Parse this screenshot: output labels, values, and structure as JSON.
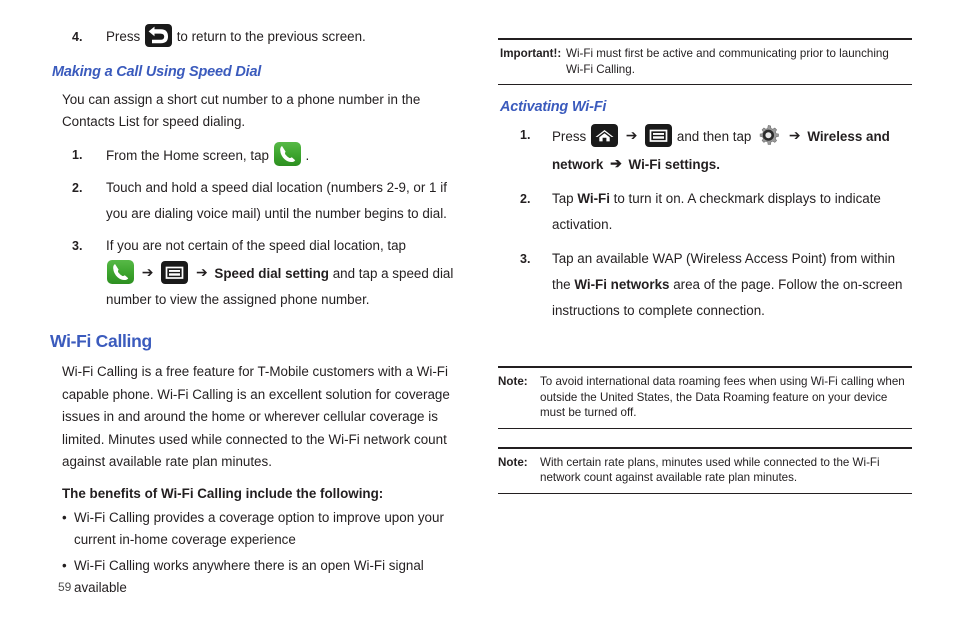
{
  "page": {
    "number": "59",
    "accent_color": "#3b5bbd",
    "text_color": "#231f20"
  },
  "left_column": {
    "step4": {
      "number": "4.",
      "text_before": "Press",
      "icon": "back-arrow-icon",
      "text_after": "to return to the previous screen."
    },
    "speed_dial_heading": "Making a Call Using Speed Dial",
    "speed_dial_intro": "You can assign a short cut number to a phone number in the Contacts List for speed dialing.",
    "speed_dial_steps": [
      {
        "number": "1.",
        "text_before": "From the Home screen, tap",
        "icon": "phone-icon",
        "text_after": "."
      },
      {
        "number": "2.",
        "text": "Touch and hold a speed dial location (numbers 2-9, or 1 if you are dialing voice mail) until the number begins to dial."
      },
      {
        "number": "3.",
        "line1": "If you are not certain of the speed dial location, tap",
        "icon1": "phone-icon",
        "arrow": "➔",
        "icon2": "menu-icon",
        "bold_text": "Speed dial setting",
        "text_after": "and tap a speed dial number to view the assigned phone number."
      }
    ],
    "wifi_calling_heading": "Wi-Fi Calling",
    "wifi_calling_body": "Wi-Fi Calling is a free feature for T-Mobile customers with a Wi-Fi capable phone. Wi-Fi Calling is an excellent solution for coverage issues in and around the home or wherever cellular coverage is limited. Minutes used while connected to the Wi-Fi network count against available rate plan minutes.",
    "benefits_heading": "The benefits of Wi-Fi Calling include the following:",
    "benefits": [
      "Wi-Fi Calling provides a coverage option to improve upon your current in-home coverage experience",
      "Wi-Fi Calling works anywhere there is an open Wi-Fi signal available"
    ],
    "bullet_glyph": "•"
  },
  "right_column": {
    "important_note": {
      "label": "Important!:",
      "text": "Wi-Fi must first be active and communicating prior to launching Wi-Fi Calling."
    },
    "activating_heading": "Activating Wi-Fi",
    "steps": [
      {
        "number": "1.",
        "text_before": "Press",
        "icon1": "home-icon",
        "arrow1": "➔",
        "icon2": "menu-icon",
        "text_middle": "and then tap",
        "icon3": "settings-gear-icon",
        "arrow2": "➔",
        "bold1": "Wireless and network",
        "arrow3": "➔",
        "bold2": "Wi-Fi settings."
      },
      {
        "number": "2.",
        "text_before": "Tap",
        "bold1": "Wi-Fi",
        "text_after": "to turn it on. A checkmark displays to indicate activation."
      },
      {
        "number": "3.",
        "text_before": "Tap an available WAP (Wireless Access Point) from within the",
        "bold1": "Wi-Fi networks",
        "text_after": "area of the page. Follow the on-screen instructions to complete connection."
      }
    ],
    "notes": [
      {
        "label": "Note:",
        "text": "To avoid international data roaming fees when using Wi-Fi calling when outside the United States, the Data Roaming feature on your device must be turned off."
      },
      {
        "label": "Note:",
        "text": "With certain rate plans, minutes used while connected to the Wi-Fi network count against available rate plan minutes."
      }
    ]
  }
}
